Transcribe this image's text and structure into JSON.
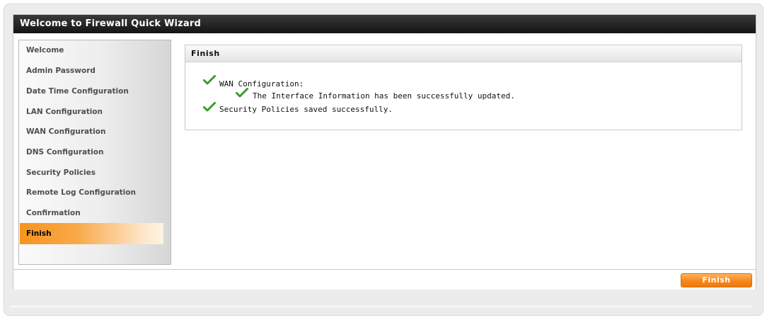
{
  "wizard": {
    "title": "Welcome to Firewall Quick Wizard"
  },
  "sidebar": {
    "items": [
      {
        "label": "Welcome"
      },
      {
        "label": "Admin Password"
      },
      {
        "label": "Date Time Configuration"
      },
      {
        "label": "LAN Configuration"
      },
      {
        "label": "WAN Configuration"
      },
      {
        "label": "DNS Configuration"
      },
      {
        "label": "Security Policies"
      },
      {
        "label": "Remote Log Configuration"
      },
      {
        "label": "Confirmation"
      },
      {
        "label": "Finish",
        "active": true
      }
    ]
  },
  "content": {
    "header": "Finish",
    "messages": [
      {
        "text": "WAN Configuration:",
        "icon": "check-icon"
      },
      {
        "text": "The Interface Information has been successfully updated.",
        "icon": "check-icon"
      },
      {
        "text": "Security Policies saved successfully.",
        "icon": "check-icon"
      }
    ]
  },
  "footer": {
    "finish_label": "Finish"
  },
  "colors": {
    "accent": "#f7871c",
    "check": "#3a9a2a",
    "title_bar": "#1f1f1f"
  }
}
